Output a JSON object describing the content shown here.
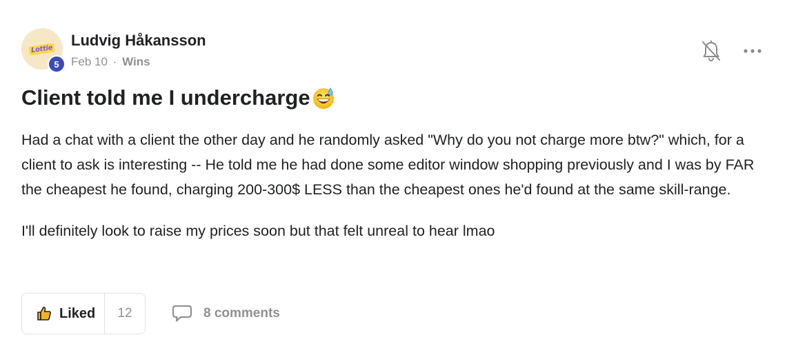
{
  "post": {
    "author": {
      "name": "Ludvig Håkansson",
      "level": "5",
      "avatar_text": "Lottie",
      "avatar_bg": "#f6e7c6",
      "level_color": "#3b4db3"
    },
    "meta": {
      "date": "Feb 10",
      "separator": "·",
      "category": "Wins"
    },
    "actions": {
      "bell_icon": "bell-off-icon",
      "more_icon": "more-horizontal-icon"
    },
    "title": "Client told me I undercharge",
    "title_emoji": "grinning-face-with-sweat",
    "body": [
      "Had a chat with a client the other day and he randomly asked \"Why do you not charge more btw?\" which, for a client to ask is interesting -- He told me he had done some editor window shopping previously and I was by FAR the cheapest he found, charging 200-300$ LESS than the cheapest ones he'd found at the same skill-range.",
      "I'll definitely look to raise my prices soon but that felt unreal to hear lmao"
    ],
    "footer": {
      "like_label": "Liked",
      "like_count": "12",
      "like_icon": "thumbs-up-icon",
      "like_icon_color": "#f0b429",
      "comments_label": "8 comments",
      "comments_icon": "comment-icon"
    }
  }
}
